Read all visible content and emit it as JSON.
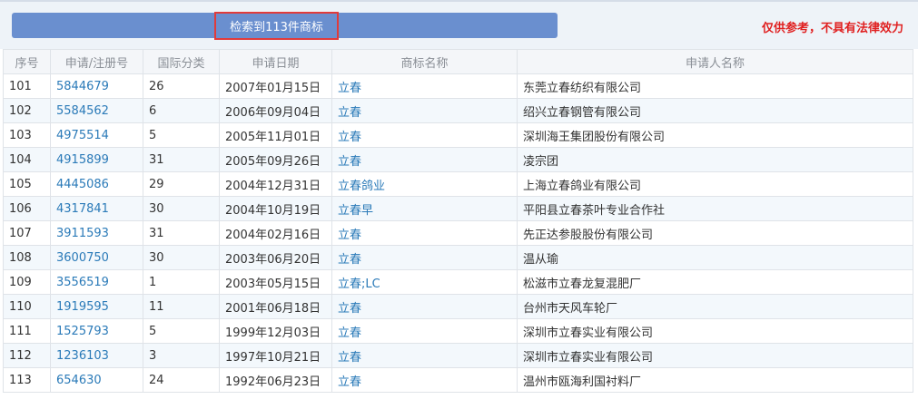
{
  "header": {
    "result_label": "检索到113件商标",
    "disclaimer": "仅供参考，不具有法律效力"
  },
  "columns": [
    "序号",
    "申请/注册号",
    "国际分类",
    "申请日期",
    "商标名称",
    "申请人名称"
  ],
  "rows": [
    {
      "index": "101",
      "reg_no": "5844679",
      "class": "26",
      "date": "2007年01月15日",
      "mark": "立春",
      "applicant": "东莞立春纺织有限公司"
    },
    {
      "index": "102",
      "reg_no": "5584562",
      "class": "6",
      "date": "2006年09月04日",
      "mark": "立春",
      "applicant": "绍兴立春钢管有限公司"
    },
    {
      "index": "103",
      "reg_no": "4975514",
      "class": "5",
      "date": "2005年11月01日",
      "mark": "立春",
      "applicant": "深圳海王集团股份有限公司"
    },
    {
      "index": "104",
      "reg_no": "4915899",
      "class": "31",
      "date": "2005年09月26日",
      "mark": "立春",
      "applicant": "凌宗团"
    },
    {
      "index": "105",
      "reg_no": "4445086",
      "class": "29",
      "date": "2004年12月31日",
      "mark": "立春鸽业",
      "applicant": "上海立春鸽业有限公司"
    },
    {
      "index": "106",
      "reg_no": "4317841",
      "class": "30",
      "date": "2004年10月19日",
      "mark": "立春早",
      "applicant": "平阳县立春茶叶专业合作社"
    },
    {
      "index": "107",
      "reg_no": "3911593",
      "class": "31",
      "date": "2004年02月16日",
      "mark": "立春",
      "applicant": "先正达参股股份有限公司"
    },
    {
      "index": "108",
      "reg_no": "3600750",
      "class": "30",
      "date": "2003年06月20日",
      "mark": "立春",
      "applicant": "温从瑜"
    },
    {
      "index": "109",
      "reg_no": "3556519",
      "class": "1",
      "date": "2003年05月15日",
      "mark": "立春;LC",
      "applicant": "松滋市立春龙复混肥厂"
    },
    {
      "index": "110",
      "reg_no": "1919595",
      "class": "11",
      "date": "2001年06月18日",
      "mark": "立春",
      "applicant": "台州市天风车轮厂"
    },
    {
      "index": "111",
      "reg_no": "1525793",
      "class": "5",
      "date": "1999年12月03日",
      "mark": "立春",
      "applicant": "深圳市立春实业有限公司"
    },
    {
      "index": "112",
      "reg_no": "1236103",
      "class": "3",
      "date": "1997年10月21日",
      "mark": "立春",
      "applicant": "深圳市立春实业有限公司"
    },
    {
      "index": "113",
      "reg_no": "654630",
      "class": "24",
      "date": "1992年06月23日",
      "mark": "立春",
      "applicant": "温州市瓯海利国衬料厂"
    }
  ],
  "colors": {
    "link": "#2a7ab8",
    "bar": "#6a8fcf",
    "alert": "#e02020"
  }
}
